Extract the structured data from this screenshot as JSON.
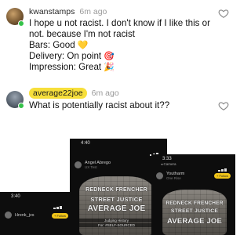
{
  "comments": [
    {
      "username": "kwanstamps",
      "time": "6m ago",
      "lines": [
        "I hope u not racist.   I don't know if I like this or",
        "not.   because I'm not racist",
        "Bars: Good",
        "Delivery: On point",
        "Impression: Great"
      ],
      "emojis": {
        "bars": "💛",
        "delivery": "🎯",
        "impression": "🎉"
      }
    },
    {
      "username": "average22joe",
      "time": "6m ago",
      "text": "What is potentially racist about it??"
    }
  ],
  "screenshots": {
    "center": {
      "status_time": "4:40",
      "user": "Angel Abrego",
      "sub": "UX Test",
      "stone_lines": [
        "REDNECK FRENCHER",
        "STREET JUSTICE",
        "AVERAGE JOE"
      ],
      "plaque": [
        "Judging History",
        "For: #SELF-SOURCED"
      ]
    },
    "left": {
      "status_time": "3:40",
      "user": "Hrenk_jvs",
      "follow": "+ Follow"
    },
    "right": {
      "status_time": "3:33",
      "camera": "◂ Camera",
      "user": "Youtharm",
      "sub": "One Rise",
      "follow": "+ Follow",
      "stone_lines": [
        "REDNECK FRENCHER",
        "STREET JUSTICE",
        "AVERAGE JOE"
      ]
    }
  },
  "colors": {
    "badge": "#f7df3b",
    "online": "#35c24a",
    "time": "#9a9a9a"
  }
}
